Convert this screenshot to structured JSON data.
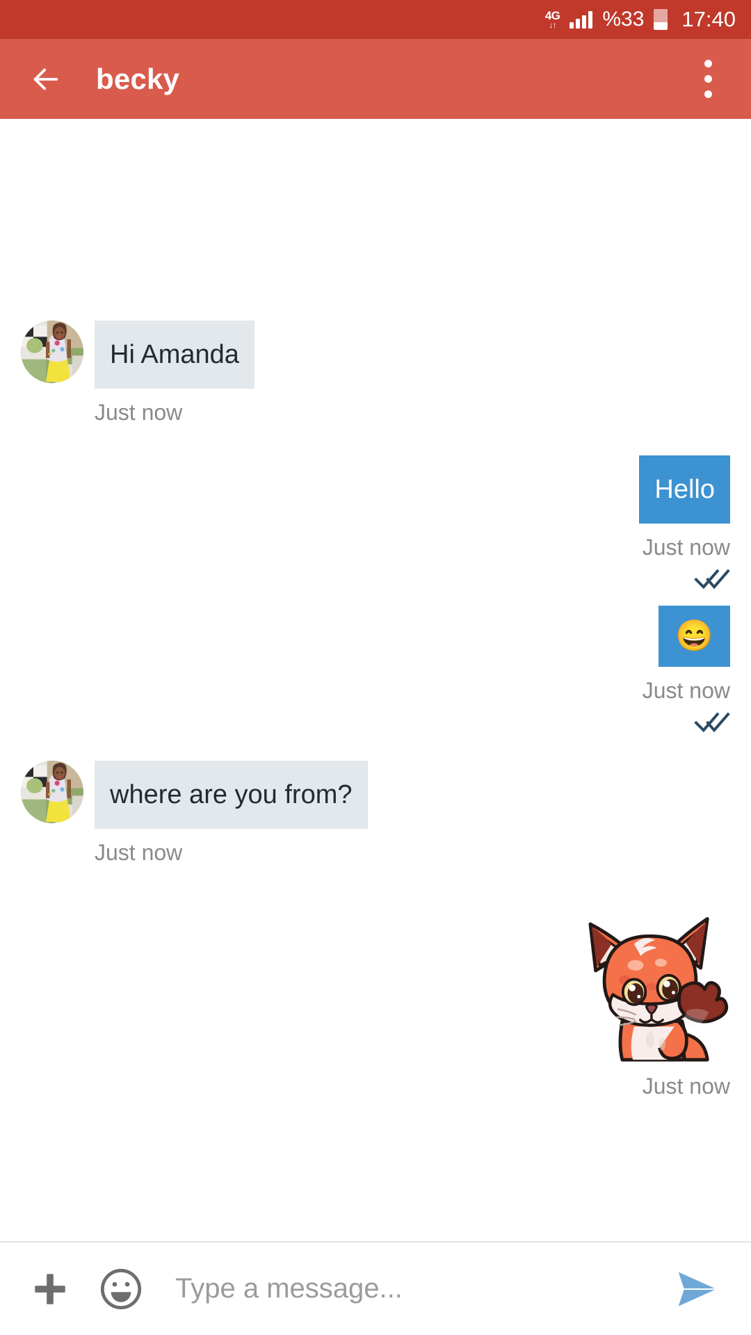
{
  "statusbar": {
    "network_type": "4G",
    "network_arrows": "↓↑",
    "signal_icon": "signal-bars-icon",
    "battery_percent": "%33",
    "battery_icon": "battery-icon",
    "clock": "17:40"
  },
  "toolbar": {
    "back_icon": "back-arrow-icon",
    "title": "becky",
    "overflow_icon": "overflow-menu-icon",
    "background_color": "#D95B4C"
  },
  "colors": {
    "statusbar_bg": "#C0392B",
    "toolbar_bg": "#D95B4C",
    "incoming_bubble": "#E3E8EC",
    "outgoing_bubble": "#3D92D1",
    "timestamp": "#8A8A8A",
    "tick_read": "#2B4A63",
    "send_accent": "#6FA8D6"
  },
  "messages": [
    {
      "id": "msg-1",
      "direction": "incoming",
      "type": "text",
      "text": "Hi Amanda",
      "timestamp": "Just now",
      "avatar": "contact-avatar"
    },
    {
      "id": "msg-2",
      "direction": "outgoing",
      "type": "text",
      "text": "Hello",
      "timestamp": "Just now",
      "status_icon": "double-check-read-icon"
    },
    {
      "id": "msg-3",
      "direction": "outgoing",
      "type": "emoji",
      "emoji": "😄",
      "emoji_name": "grinning-face-with-smiling-eyes",
      "timestamp": "Just now",
      "status_icon": "double-check-read-icon"
    },
    {
      "id": "msg-4",
      "direction": "incoming",
      "type": "text",
      "text": "where are you from?",
      "timestamp": "Just now",
      "avatar": "contact-avatar"
    },
    {
      "id": "msg-5",
      "direction": "outgoing",
      "type": "sticker",
      "sticker_name": "waving-fox-sticker",
      "timestamp": "Just now"
    }
  ],
  "inputbar": {
    "attach_icon": "plus-attach-icon",
    "emoji_icon": "emoji-face-icon",
    "placeholder": "Type a message...",
    "value": "",
    "send_icon": "send-paper-plane-icon"
  }
}
